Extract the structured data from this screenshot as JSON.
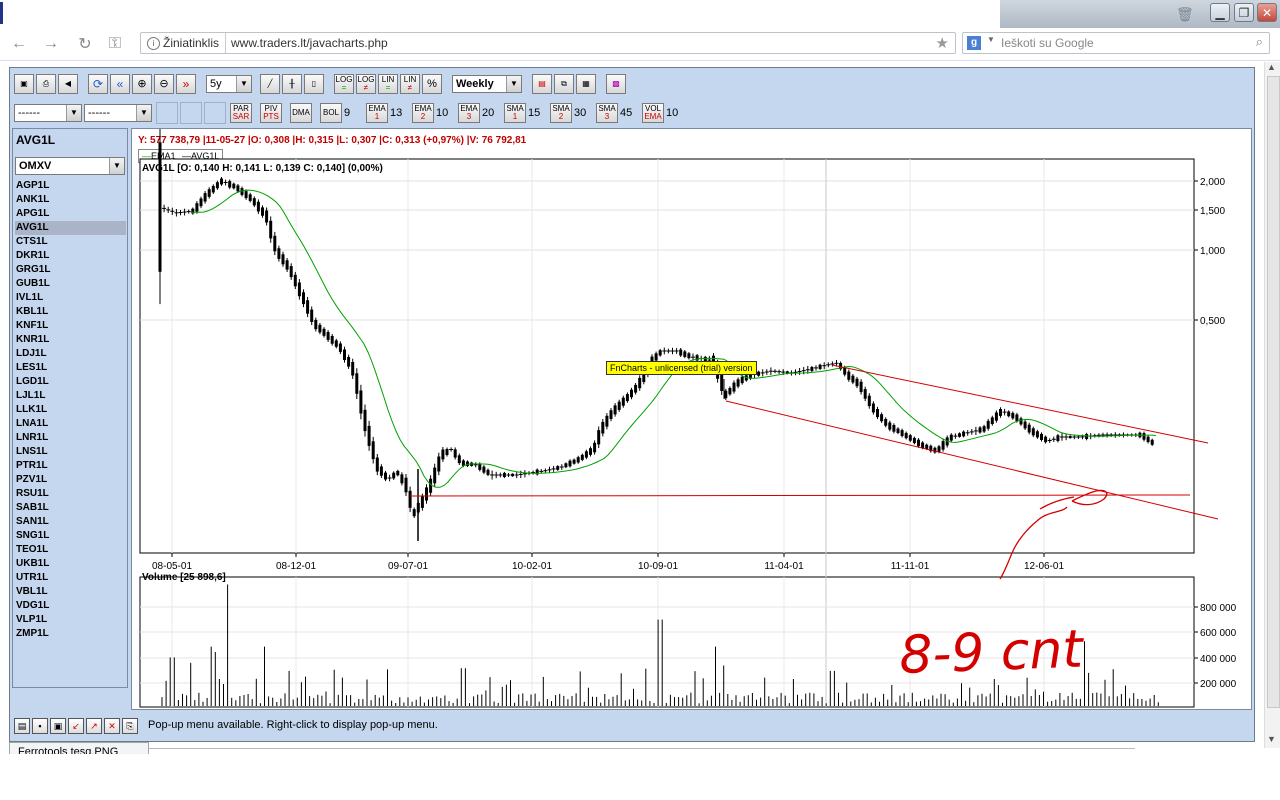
{
  "browser": {
    "info_label": "Žiniatinklis",
    "url": "www.traders.lt/javacharts.php",
    "search_placeholder": "Ieškoti su Google",
    "bottom_tab": "Ferrotools tesq.PNG"
  },
  "toolbar1": {
    "period": "5y",
    "interval": "Weekly",
    "scale_buttons": [
      {
        "line1": "LOG",
        "line2": "="
      },
      {
        "line1": "LOG",
        "line2": "≠"
      },
      {
        "line1": "LIN",
        "line2": "="
      },
      {
        "line1": "LIN",
        "line2": "≠"
      },
      {
        "line1": "%",
        "line2": ""
      }
    ]
  },
  "toolbar2": {
    "select_a": "------",
    "select_b": "------",
    "indicators": [
      {
        "top": "PAR",
        "bottom": "SAR",
        "value": ""
      },
      {
        "top": "PIV",
        "bottom": "PTS",
        "value": ""
      },
      {
        "top": "DMA",
        "bottom": "",
        "value": ""
      },
      {
        "top": "BOL",
        "bottom": "",
        "value": "9"
      },
      {
        "top": "EMA",
        "bottom": "1",
        "value": "13"
      },
      {
        "top": "EMA",
        "bottom": "2",
        "value": "10"
      },
      {
        "top": "EMA",
        "bottom": "3",
        "value": "20"
      },
      {
        "top": "SMA",
        "bottom": "1",
        "value": "15"
      },
      {
        "top": "SMA",
        "bottom": "2",
        "value": "30"
      },
      {
        "top": "SMA",
        "bottom": "3",
        "value": "45"
      },
      {
        "top": "VOL",
        "bottom": "EMA",
        "value": "10"
      }
    ]
  },
  "sidebar": {
    "current_symbol": "AVG1L",
    "market": "OMXV",
    "selected": "AVG1L",
    "symbols": [
      "AGP1L",
      "ANK1L",
      "APG1L",
      "AVG1L",
      "CTS1L",
      "DKR1L",
      "GRG1L",
      "GUB1L",
      "IVL1L",
      "KBL1L",
      "KNF1L",
      "KNR1L",
      "LDJ1L",
      "LES1L",
      "LGD1L",
      "LJL1L",
      "LLK1L",
      "LNA1L",
      "LNR1L",
      "LNS1L",
      "PTR1L",
      "PZV1L",
      "RSU1L",
      "SAB1L",
      "SAN1L",
      "SNG1L",
      "TEO1L",
      "UKB1L",
      "UTR1L",
      "VBL1L",
      "VDG1L",
      "VLP1L",
      "ZMP1L"
    ]
  },
  "chart": {
    "info_line": "Y: 577 738,79 |11-05-27 |O: 0,308 |H: 0,315 |L: 0,307 |C: 0,313 (+0,97%) |V: 76 792,81",
    "legend": [
      "EMA1",
      "AVG1L"
    ],
    "price_title": "AVG1L [O: 0,140  H: 0,141  L: 0,139  C: 0,140] (0,00%)",
    "watermark": "FnCharts - unlicensed (trial) version",
    "volume_title": "Volume [25 898,6]",
    "handwriting": "8-9 cnt",
    "colors": {
      "price": "#000000",
      "ema": "#00a000",
      "lines": "#d40000",
      "info": "#c00000"
    }
  },
  "status": {
    "message": "Pop-up menu available. Right-click to display pop-up menu."
  },
  "chart_data": {
    "type": "line",
    "series": [
      {
        "name": "AVG1L",
        "values": []
      },
      {
        "name": "EMA1",
        "values": []
      }
    ],
    "x_ticks": [
      "08-05-01",
      "08-12-01",
      "09-07-01",
      "10-02-01",
      "10-09-01",
      "11-04-01",
      "11-11-01",
      "12-06-01"
    ],
    "y_ticks": [
      "2,000",
      "1,500",
      "1,000",
      "0,500"
    ],
    "y_scale": "log",
    "volume_ticks": [
      "800 000",
      "600 000",
      "400 000",
      "200 000"
    ]
  }
}
